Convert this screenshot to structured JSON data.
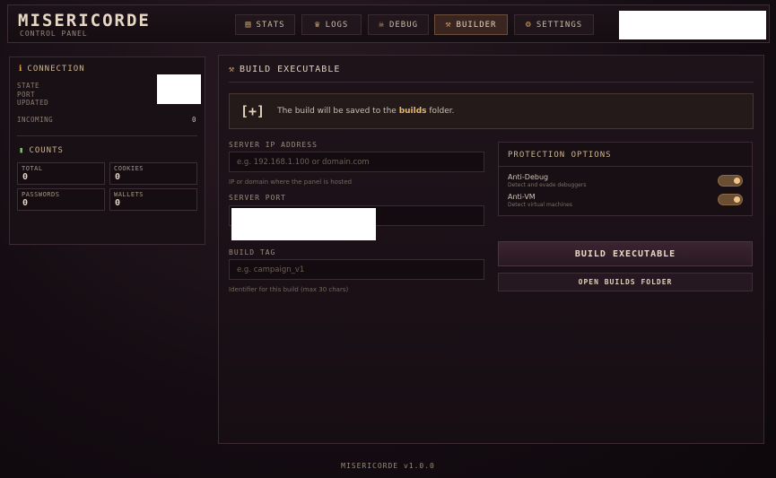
{
  "app": {
    "title": "MISERICORDE",
    "subtitle": "CONTROL PANEL"
  },
  "nav": [
    {
      "label": "STATS",
      "icon": "document-icon"
    },
    {
      "label": "LOGS",
      "icon": "crown-icon"
    },
    {
      "label": "DEBUG",
      "icon": "skull-icon"
    },
    {
      "label": "BUILDER",
      "icon": "hammer-icon",
      "active": true
    },
    {
      "label": "SETTINGS",
      "icon": "gear-icon"
    }
  ],
  "sidebar": {
    "connection": {
      "title": "CONNECTION",
      "state_label": "STATE",
      "port_label": "PORT",
      "updated_label": "UPDATED",
      "incoming_label": "INCOMING",
      "incoming_value": "0"
    },
    "counts": {
      "title": "COUNTS",
      "items": [
        {
          "label": "TOTAL",
          "value": "0"
        },
        {
          "label": "COOKIES",
          "value": "0"
        },
        {
          "label": "PASSWORDS",
          "value": "0"
        },
        {
          "label": "WALLETS",
          "value": "0"
        }
      ]
    }
  },
  "builder": {
    "title": "BUILD EXECUTABLE",
    "notice": {
      "icon": "[+]",
      "prefix": "The build will be saved to the ",
      "folder": "builds",
      "suffix": " folder."
    },
    "server_ip": {
      "label": "SERVER IP ADDRESS",
      "placeholder": "e.g. 192.168.1.100 or domain.com",
      "value": "",
      "hint": "IP or domain where the panel is hosted"
    },
    "server_port": {
      "label": "SERVER PORT"
    },
    "build_tag": {
      "label": "BUILD TAG",
      "placeholder": "e.g. campaign_v1",
      "value": "",
      "hint": "Identifier for this build (max 30 chars)"
    },
    "protection": {
      "title": "PROTECTION OPTIONS",
      "options": [
        {
          "name": "Anti-Debug",
          "desc": "Detect and evade debuggers",
          "enabled": true
        },
        {
          "name": "Anti-VM",
          "desc": "Detect virtual machines",
          "enabled": true
        }
      ]
    },
    "build_button": "BUILD EXECUTABLE",
    "open_folder_button": "OPEN BUILDS FOLDER"
  },
  "footer": "MISERICORDE v1.0.0",
  "colors": {
    "accent": "#cdb48e",
    "background": "#140c12",
    "toggle_on": "#f0c58a"
  }
}
